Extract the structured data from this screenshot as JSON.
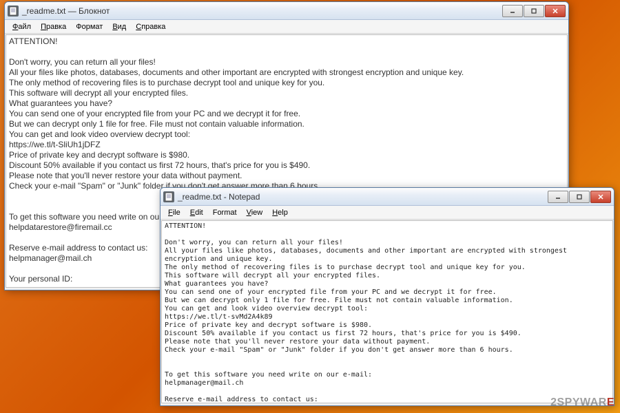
{
  "window1": {
    "title": "_readme.txt — Блокнот",
    "menu": [
      "Файл",
      "Правка",
      "Формат",
      "Вид",
      "Справка"
    ],
    "body": "ATTENTION!\n\nDon't worry, you can return all your files!\nAll your files like photos, databases, documents and other important are encrypted with strongest encryption and unique key.\nThe only method of recovering files is to purchase decrypt tool and unique key for you.\nThis software will decrypt all your encrypted files.\nWhat guarantees you have?\nYou can send one of your encrypted file from your PC and we decrypt it for free.\nBut we can decrypt only 1 file for free. File must not contain valuable information.\nYou can get and look video overview decrypt tool:\nhttps://we.tl/t-SliUh1jDFZ\nPrice of private key and decrypt software is $980.\nDiscount 50% available if you contact us first 72 hours, that's price for you is $490.\nPlease note that you'll never restore your data without payment.\nCheck your e-mail \"Spam\" or \"Junk\" folder if you don't get answer more than 6 hours.\n\n\nTo get this software you need write on our e-mail:\nhelpdatarestore@firemail.cc\n\nReserve e-mail address to contact us:\nhelpmanager@mail.ch\n\nYour personal ID:"
  },
  "window2": {
    "title": "_readme.txt - Notepad",
    "menu": [
      "File",
      "Edit",
      "Format",
      "View",
      "Help"
    ],
    "body": "ATTENTION!\n\nDon't worry, you can return all your files!\nAll your files like photos, databases, documents and other important are encrypted with strongest encryption and unique key.\nThe only method of recovering files is to purchase decrypt tool and unique key for you.\nThis software will decrypt all your encrypted files.\nWhat guarantees you have?\nYou can send one of your encrypted file from your PC and we decrypt it for free.\nBut we can decrypt only 1 file for free. File must not contain valuable information.\nYou can get and look video overview decrypt tool:\nhttps://we.tl/t-svMd2A4k89\nPrice of private key and decrypt software is $980.\nDiscount 50% available if you contact us first 72 hours, that's price for you is $490.\nPlease note that you'll never restore your data without payment.\nCheck your e-mail \"Spam\" or \"Junk\" folder if you don't get answer more than 6 hours.\n\n\nTo get this software you need write on our e-mail:\nhelpmanager@mail.ch\n\nReserve e-mail address to contact us:\nhelpdatarestore@firemail.cc\n\nYour personal ID:"
  },
  "watermark": {
    "left": "2SPYWAR",
    "right": "E"
  }
}
